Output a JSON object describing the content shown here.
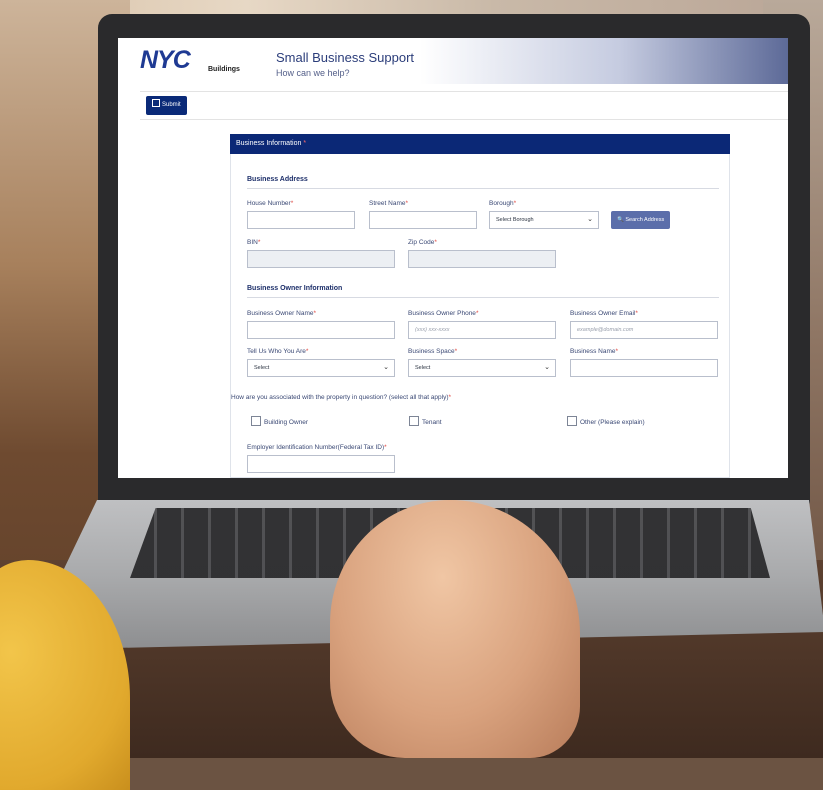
{
  "header": {
    "logo_text": "NYC",
    "logo_subtext": "Buildings",
    "title": "Small Business Support",
    "subtitle": "How can we help?"
  },
  "toolbar": {
    "submit_label": "Submit"
  },
  "section": {
    "title": "Business Information",
    "required_mark": "*"
  },
  "business_address": {
    "heading": "Business Address",
    "house_number_label": "House Number",
    "street_name_label": "Street Name",
    "borough_label": "Borough",
    "borough_value": "Select Borough",
    "search_button": "Search Address",
    "bin_label": "BIN",
    "zip_label": "Zip Code"
  },
  "owner_info": {
    "heading": "Business Owner Information",
    "owner_name_label": "Business Owner Name",
    "owner_phone_label": "Business Owner Phone",
    "owner_phone_placeholder": "(xxx) xxx-xxxx",
    "owner_email_label": "Business Owner Email",
    "owner_email_placeholder": "example@domain.com",
    "who_label": "Tell Us Who You Are",
    "who_value": "Select",
    "space_label": "Business Space",
    "space_value": "Select",
    "business_name_label": "Business Name"
  },
  "association": {
    "question": "How are you associated with the property in question? (select all that apply)",
    "options": [
      "Building Owner",
      "Tenant",
      "Other (Please explain)"
    ]
  },
  "ein": {
    "label": "Employer Identification Number(Federal Tax ID)"
  },
  "required_star": "*",
  "colors": {
    "nav": "#0b2876",
    "accent": "#5b6eaa",
    "required": "#e0463f"
  }
}
